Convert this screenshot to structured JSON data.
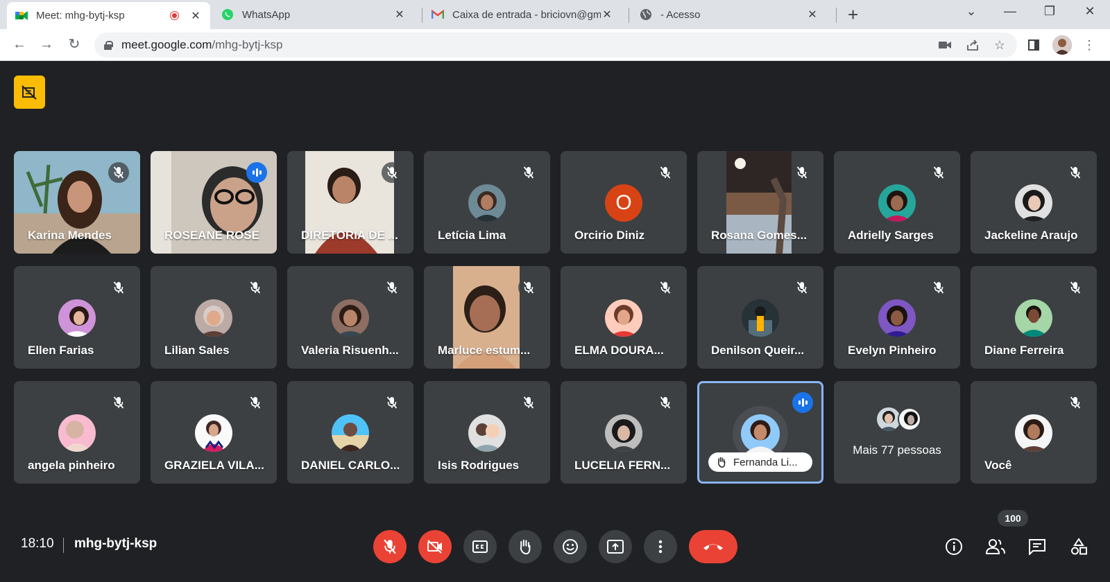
{
  "browser": {
    "tabs": [
      {
        "title": "Meet: mhg-bytj-ksp",
        "icon": "google-meet-icon"
      },
      {
        "title": "WhatsApp",
        "icon": "whatsapp-icon"
      },
      {
        "title": "Caixa de entrada - briciovn@gma",
        "icon": "gmail-icon"
      },
      {
        "title": "- Acesso",
        "icon": "globe-icon"
      }
    ],
    "url_host": "meet.google.com",
    "url_path": "/mhg-bytj-ksp"
  },
  "participants": [
    {
      "name": "Karina Mendes"
    },
    {
      "name": "ROSEANE ROSE"
    },
    {
      "name": "DIRETORIA DE ..."
    },
    {
      "name": "Letícia Lima"
    },
    {
      "name": "Orcirio Diniz",
      "initial": "O"
    },
    {
      "name": "Rosana Gomes..."
    },
    {
      "name": "Adrielly Sarges"
    },
    {
      "name": "Jackeline Araujo"
    },
    {
      "name": "Ellen Farias"
    },
    {
      "name": "Lilian Sales"
    },
    {
      "name": "Valeria Risuenh..."
    },
    {
      "name": "Marluce estum..."
    },
    {
      "name": "ELMA DOURA..."
    },
    {
      "name": "Denilson Queir..."
    },
    {
      "name": "Evelyn Pinheiro"
    },
    {
      "name": "Diane Ferreira"
    },
    {
      "name": "angela pinheiro"
    },
    {
      "name": "GRAZIELA VILA..."
    },
    {
      "name": "DANIEL CARLO..."
    },
    {
      "name": "Isis Rodrigues"
    },
    {
      "name": "LUCELIA FERN..."
    },
    {
      "name": "Fernanda Li..."
    },
    {
      "name": "Mais 77 pessoas"
    },
    {
      "name": "Você"
    }
  ],
  "meeting": {
    "time": "18:10",
    "code": "mhg-bytj-ksp",
    "people_count": "100"
  },
  "colors": {
    "background": "#202124",
    "tile": "#3c4043",
    "danger": "#ea4335",
    "accent": "#1a73e8",
    "warning": "#fbbc04"
  }
}
